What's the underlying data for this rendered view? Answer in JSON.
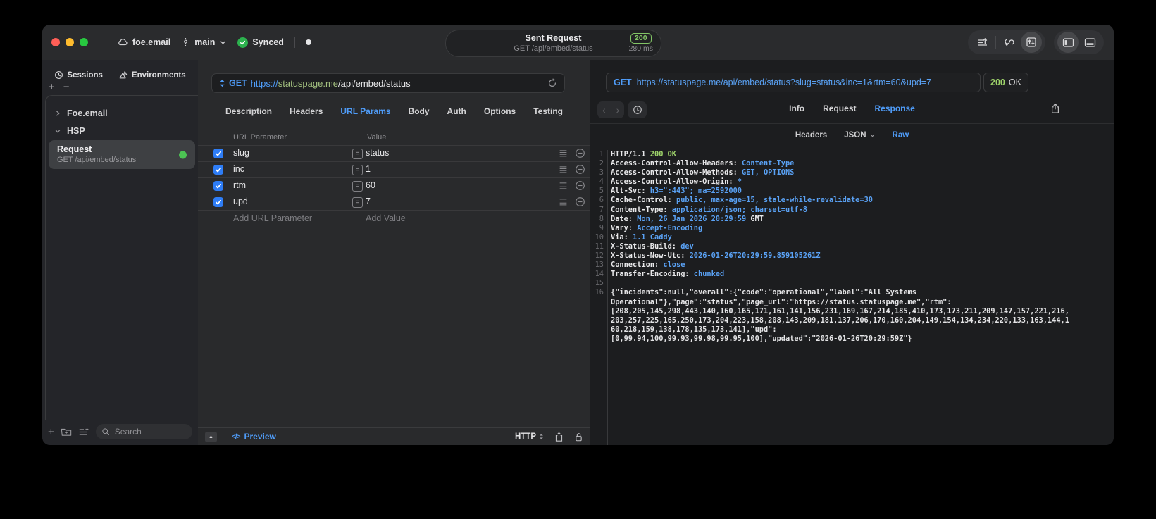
{
  "colors": {
    "accent": "#4f9cf8",
    "codeblue": "#5aa2f5",
    "green": "#9ed36a",
    "badge": "#82c566",
    "check": "#2e7df6",
    "dot": "#4cc353",
    "host": "#a3c07f",
    "light_red": "#ff5f57",
    "light_yellow": "#febc2e",
    "light_green": "#28c840"
  },
  "titlebar": {
    "project": "foe.email",
    "branch": "main",
    "sync": "Synced",
    "pill": {
      "title": "Sent Request",
      "subtitle": "GET /api/embed/status",
      "status": "200",
      "time": "280 ms"
    }
  },
  "sidebar": {
    "tabs": [
      {
        "label": "Sessions",
        "icon": "clock-icon"
      },
      {
        "label": "Environments",
        "icon": "layers-icon"
      }
    ],
    "tree": [
      {
        "label": "Foe.email",
        "expanded": false
      },
      {
        "label": "HSP",
        "expanded": true
      }
    ],
    "request_item": {
      "title": "Request",
      "subtitle": "GET /api/embed/status"
    },
    "search_placeholder": "Search"
  },
  "request_editor": {
    "method": "GET",
    "url": {
      "scheme": "https://",
      "host": "statuspage.me",
      "path": "/api/embed/status"
    },
    "tabs": [
      "Description",
      "Headers",
      "URL Params",
      "Body",
      "Auth",
      "Options",
      "Testing"
    ],
    "active_tab": "URL Params",
    "params_table": {
      "columns": [
        "URL Parameter",
        "Value"
      ],
      "rows": [
        {
          "name": "slug",
          "value": "status",
          "enabled": true
        },
        {
          "name": "inc",
          "value": "1",
          "enabled": true
        },
        {
          "name": "rtm",
          "value": "60",
          "enabled": true
        },
        {
          "name": "upd",
          "value": "7",
          "enabled": true
        }
      ],
      "add_name": "Add URL Parameter",
      "add_value": "Add Value"
    },
    "footer": {
      "preview": "Preview",
      "protocol": "HTTP"
    }
  },
  "response_viewer": {
    "method": "GET",
    "url": "https://statuspage.me/api/embed/status?slug=status&inc=1&rtm=60&upd=7",
    "status_code": "200",
    "status_text": "OK",
    "tabs": [
      "Info",
      "Request",
      "Response"
    ],
    "active_tab": "Response",
    "subtabs": [
      {
        "label": "Headers"
      },
      {
        "label": "JSON",
        "dropdown": true
      },
      {
        "label": "Raw",
        "active": true
      }
    ],
    "code": {
      "header_lines": [
        {
          "num": 1,
          "segs": [
            {
              "t": "HTTP/1.1 ",
              "c": "w"
            },
            {
              "t": "200 OK",
              "c": "g"
            }
          ]
        },
        {
          "num": 2,
          "segs": [
            {
              "t": "Access-Control-Allow-Headers: ",
              "c": "w"
            },
            {
              "t": "Content-Type",
              "c": "b"
            }
          ]
        },
        {
          "num": 3,
          "segs": [
            {
              "t": "Access-Control-Allow-Methods: ",
              "c": "w"
            },
            {
              "t": "GET, OPTIONS",
              "c": "b"
            }
          ]
        },
        {
          "num": 4,
          "segs": [
            {
              "t": "Access-Control-Allow-Origin: ",
              "c": "w"
            },
            {
              "t": "*",
              "c": "b"
            }
          ]
        },
        {
          "num": 5,
          "segs": [
            {
              "t": "Alt-Svc: ",
              "c": "w"
            },
            {
              "t": "h3=\":443\"; ma=2592000",
              "c": "b"
            }
          ]
        },
        {
          "num": 6,
          "segs": [
            {
              "t": "Cache-Control: ",
              "c": "w"
            },
            {
              "t": "public, max-age=15, stale-while-revalidate=30",
              "c": "b"
            }
          ]
        },
        {
          "num": 7,
          "segs": [
            {
              "t": "Content-Type: ",
              "c": "w"
            },
            {
              "t": "application/json; charset=utf-8",
              "c": "b"
            }
          ]
        },
        {
          "num": 8,
          "segs": [
            {
              "t": "Date: ",
              "c": "w"
            },
            {
              "t": "Mon, 26 Jan 2026 20:29:59",
              "c": "b"
            },
            {
              "t": " GMT",
              "c": "w"
            }
          ]
        },
        {
          "num": 9,
          "segs": [
            {
              "t": "Vary: ",
              "c": "w"
            },
            {
              "t": "Accept-Encoding",
              "c": "b"
            }
          ]
        },
        {
          "num": 10,
          "segs": [
            {
              "t": "Via: ",
              "c": "w"
            },
            {
              "t": "1.1 Caddy",
              "c": "b"
            }
          ]
        },
        {
          "num": 11,
          "segs": [
            {
              "t": "X-Status-Build: ",
              "c": "w"
            },
            {
              "t": "dev",
              "c": "b"
            }
          ]
        },
        {
          "num": 12,
          "segs": [
            {
              "t": "X-Status-Now-Utc: ",
              "c": "w"
            },
            {
              "t": "2026-01-26T20:29:59.859105261Z",
              "c": "b"
            }
          ]
        },
        {
          "num": 13,
          "segs": [
            {
              "t": "Connection: ",
              "c": "w"
            },
            {
              "t": "close",
              "c": "b"
            }
          ]
        },
        {
          "num": 14,
          "segs": [
            {
              "t": "Transfer-Encoding: ",
              "c": "w"
            },
            {
              "t": "chunked",
              "c": "b"
            }
          ]
        },
        {
          "num": 15,
          "segs": []
        }
      ],
      "body_start_num": 16,
      "body_lines": [
        "{\"incidents\":null,\"overall\":{\"code\":\"operational\",\"label\":\"All Systems",
        "Operational\"},\"page\":\"status\",\"page_url\":\"https://status.statuspage.me\",\"rtm\":",
        "[208,205,145,298,443,140,160,165,171,161,141,156,231,169,167,214,185,410,173,173,211,209,147,157,221,216,",
        "203,257,225,165,250,173,204,223,158,208,143,209,181,137,206,170,160,204,149,154,134,234,220,133,163,144,1",
        "60,218,159,138,178,135,173,141],\"upd\":",
        "[0,99.94,100,99.93,99.98,99.95,100],\"updated\":\"2026-01-26T20:29:59Z\"}"
      ]
    }
  }
}
